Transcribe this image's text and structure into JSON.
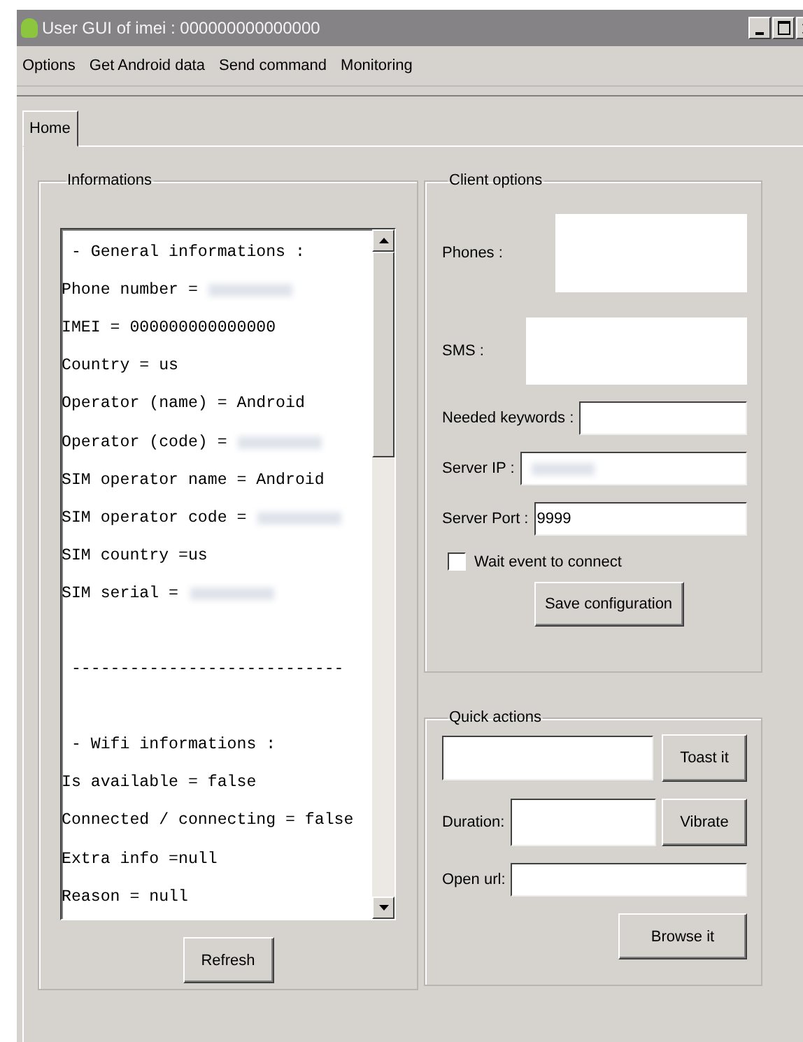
{
  "window": {
    "title": "User GUI of imei : 000000000000000"
  },
  "menu": [
    "Options",
    "Get Android data",
    "Send command",
    "Monitoring"
  ],
  "tabs": [
    {
      "label": "Home",
      "selected": true
    }
  ],
  "informations": {
    "title": "Informations",
    "lines": [
      {
        "kind": "text",
        "text": " - General informations :"
      },
      {
        "kind": "text",
        "text": "Phone number =",
        "redacted": true
      },
      {
        "kind": "text",
        "text": "IMEI = 000000000000000"
      },
      {
        "kind": "text",
        "text": "Country = us"
      },
      {
        "kind": "text",
        "text": "Operator (name) = Android"
      },
      {
        "kind": "text",
        "text": "Operator (code) =",
        "redacted": true
      },
      {
        "kind": "text",
        "text": "SIM operator name = Android"
      },
      {
        "kind": "text",
        "text": "SIM operator code =",
        "redacted": true
      },
      {
        "kind": "text",
        "text": "SIM country =us"
      },
      {
        "kind": "text",
        "text": "SIM serial =",
        "redacted": true
      },
      {
        "kind": "blank"
      },
      {
        "kind": "text",
        "text": " ----------------------------"
      },
      {
        "kind": "blank"
      },
      {
        "kind": "text",
        "text": " - Wifi informations :"
      },
      {
        "kind": "text",
        "text": "Is available = false"
      },
      {
        "kind": "text",
        "text": "Connected / connecting = false"
      },
      {
        "kind": "text",
        "text": "Extra info =null"
      },
      {
        "kind": "text",
        "text": "Reason = null"
      }
    ],
    "button": "Refresh"
  },
  "client_options": {
    "title": "Client options",
    "phones_label": "Phones :",
    "sms_label": "SMS :",
    "keywords_label": "Needed keywords :",
    "server_ip_label": "Server IP :",
    "server_ip_redacted": true,
    "server_port_label": "Server Port :",
    "server_port_value": "9999",
    "wait_event": {
      "label": "Wait event to connect",
      "checked": false
    },
    "button": "Save configuration"
  },
  "quick_actions": {
    "title": "Quick actions",
    "toast_button": "Toast it",
    "duration_label": "Duration:",
    "vibrate_button": "Vibrate",
    "url_label": "Open url:",
    "browse_button": "Browse it"
  }
}
